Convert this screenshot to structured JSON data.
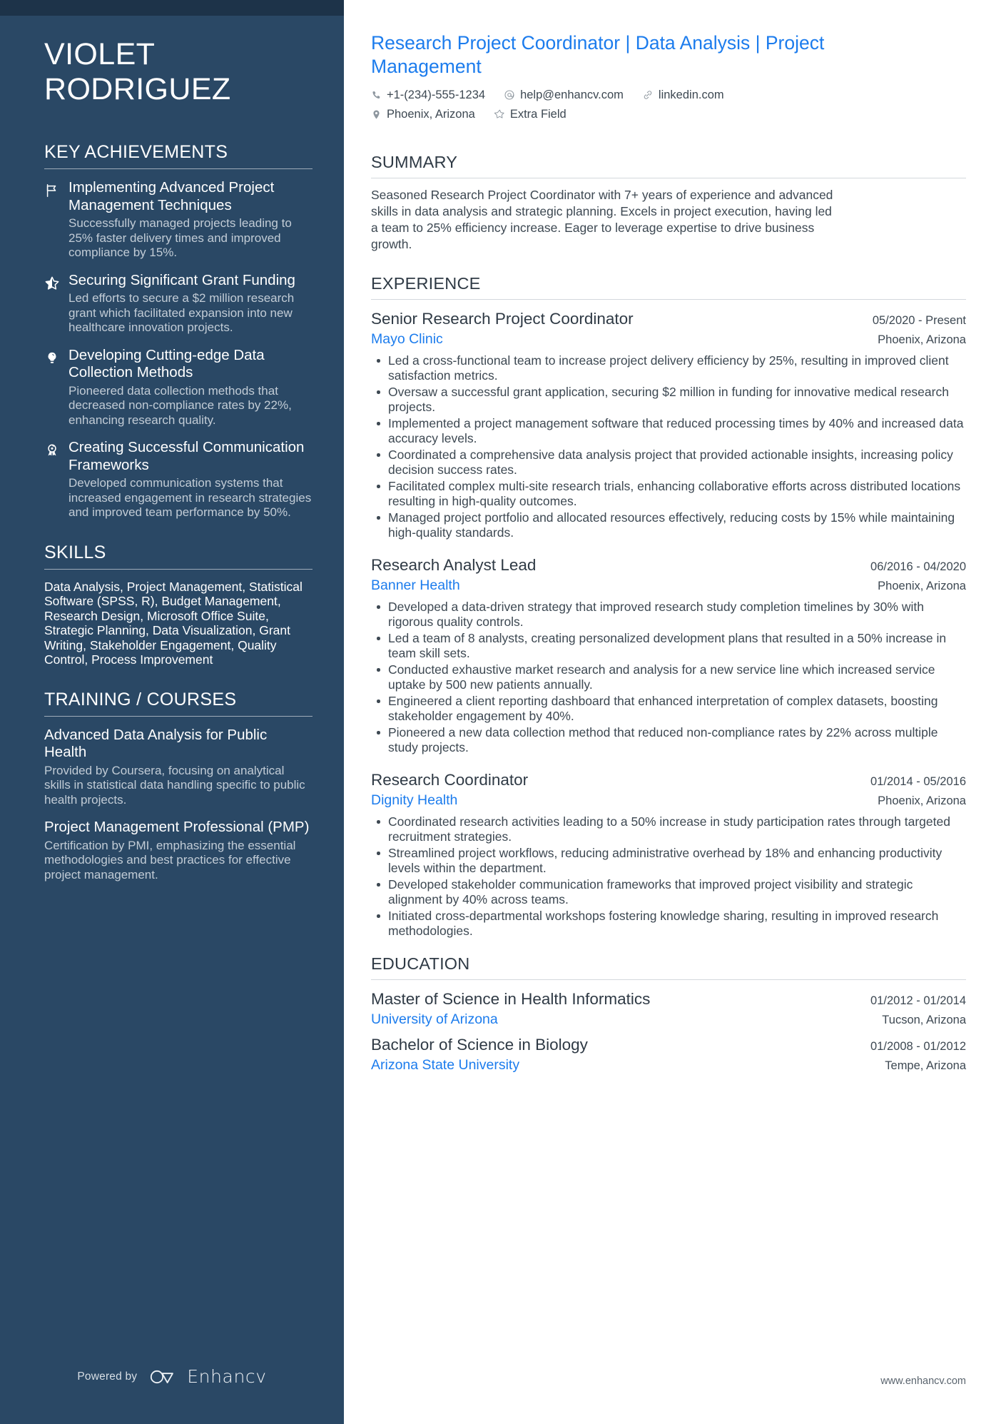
{
  "sidebar": {
    "name_first": "VIOLET",
    "name_last": "RODRIGUEZ",
    "achievements_title": "KEY ACHIEVEMENTS",
    "achievements": [
      {
        "icon": "flag-icon",
        "title": "Implementing Advanced Project Management Techniques",
        "description": "Successfully managed projects leading to 25% faster delivery times and improved compliance by 15%."
      },
      {
        "icon": "star-half-icon",
        "title": "Securing Significant Grant Funding",
        "description": "Led efforts to secure a $2 million research grant which facilitated expansion into new healthcare innovation projects."
      },
      {
        "icon": "lightbulb-icon",
        "title": "Developing Cutting-edge Data Collection Methods",
        "description": "Pioneered data collection methods that decreased non-compliance rates by 22%, enhancing research quality."
      },
      {
        "icon": "award-ribbon-icon",
        "title": "Creating Successful Communication Frameworks",
        "description": "Developed communication systems that increased engagement in research strategies and improved team performance by 50%."
      }
    ],
    "skills_title": "SKILLS",
    "skills_text": "Data Analysis, Project Management, Statistical Software (SPSS, R), Budget Management, Research Design, Microsoft Office Suite, Strategic Planning, Data Visualization, Grant Writing, Stakeholder Engagement, Quality Control, Process Improvement",
    "training_title": "TRAINING / COURSES",
    "courses": [
      {
        "title": "Advanced Data Analysis for Public Health",
        "description": "Provided by Coursera, focusing on analytical skills in statistical data handling specific to public health projects."
      },
      {
        "title": "Project Management Professional (PMP)",
        "description": "Certification by PMI, emphasizing the essential methodologies and best practices for effective project management."
      }
    ],
    "footer": {
      "powered_by": "Powered by",
      "brand": "Enhancv"
    }
  },
  "main": {
    "headline": "Research Project Coordinator | Data Analysis | Project Management",
    "contacts_row1": [
      {
        "icon": "phone-icon",
        "text": "+1-(234)-555-1234"
      },
      {
        "icon": "at-email-icon",
        "text": "help@enhancv.com"
      },
      {
        "icon": "link-icon",
        "text": "linkedin.com"
      }
    ],
    "contacts_row2": [
      {
        "icon": "location-pin-icon",
        "text": "Phoenix, Arizona"
      },
      {
        "icon": "star-outline-icon",
        "text": "Extra Field"
      }
    ],
    "summary_title": "SUMMARY",
    "summary_text": "Seasoned Research Project Coordinator with 7+ years of experience and advanced skills in data analysis and strategic planning. Excels in project execution, having led a team to 25% efficiency increase. Eager to leverage expertise to drive business growth.",
    "experience_title": "EXPERIENCE",
    "experience": [
      {
        "title": "Senior Research Project Coordinator",
        "date": "05/2020 - Present",
        "org": "Mayo Clinic",
        "location": "Phoenix, Arizona",
        "bullets": [
          "Led a cross-functional team to increase project delivery efficiency by 25%, resulting in improved client satisfaction metrics.",
          "Oversaw a successful grant application, securing $2 million in funding for innovative medical research projects.",
          "Implemented a project management software that reduced processing times by 40% and increased data accuracy levels.",
          "Coordinated a comprehensive data analysis project that provided actionable insights, increasing policy decision success rates.",
          "Facilitated complex multi-site research trials, enhancing collaborative efforts across distributed locations resulting in high-quality outcomes.",
          "Managed project portfolio and allocated resources effectively, reducing costs by 15% while maintaining high-quality standards."
        ]
      },
      {
        "title": "Research Analyst Lead",
        "date": "06/2016 - 04/2020",
        "org": "Banner Health",
        "location": "Phoenix, Arizona",
        "bullets": [
          "Developed a data-driven strategy that improved research study completion timelines by 30% with rigorous quality controls.",
          "Led a team of 8 analysts, creating personalized development plans that resulted in a 50% increase in team skill sets.",
          "Conducted exhaustive market research and analysis for a new service line which increased service uptake by 500 new patients annually.",
          "Engineered a client reporting dashboard that enhanced interpretation of complex datasets, boosting stakeholder engagement by 40%.",
          "Pioneered a new data collection method that reduced non-compliance rates by 22% across multiple study projects."
        ]
      },
      {
        "title": "Research Coordinator",
        "date": "01/2014 - 05/2016",
        "org": "Dignity Health",
        "location": "Phoenix, Arizona",
        "bullets": [
          "Coordinated research activities leading to a 50% increase in study participation rates through targeted recruitment strategies.",
          "Streamlined project workflows, reducing administrative overhead by 18% and enhancing productivity levels within the department.",
          "Developed stakeholder communication frameworks that improved project visibility and strategic alignment by 40% across teams.",
          "Initiated cross-departmental workshops fostering knowledge sharing, resulting in improved research methodologies."
        ]
      }
    ],
    "education_title": "EDUCATION",
    "education": [
      {
        "title": "Master of Science in Health Informatics",
        "date": "01/2012 - 01/2014",
        "org": "University of Arizona",
        "location": "Tucson, Arizona"
      },
      {
        "title": "Bachelor of Science in Biology",
        "date": "01/2008 - 01/2012",
        "org": "Arizona State University",
        "location": "Tempe, Arizona"
      }
    ],
    "footer_url": "www.enhancv.com"
  },
  "colors": {
    "sidebar_bg": "#2a4865",
    "sidebar_topbar": "#1d3349",
    "accent_blue": "#1c7ced",
    "body_text": "#3d4852",
    "heading_text": "#2f3a45",
    "muted_sidebar_text": "#c2ccd6"
  }
}
